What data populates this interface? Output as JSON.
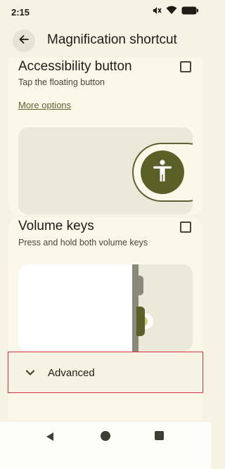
{
  "status_bar": {
    "time": "2:15",
    "icons": [
      "mute-icon",
      "wifi-icon",
      "battery-icon"
    ]
  },
  "app_bar": {
    "title": "Magnification shortcut",
    "back_icon": "arrow-back-icon"
  },
  "options": [
    {
      "title": "Accessibility button",
      "description": "Tap the floating button",
      "link": "More options",
      "checked": false,
      "preview_icon": "accessibility-person-icon"
    },
    {
      "title": "Volume keys",
      "description": "Press and hold both volume keys",
      "checked": false
    }
  ],
  "advanced": {
    "label": "Advanced",
    "icon": "chevron-down-icon"
  },
  "nav_bar": {
    "icons": [
      "nav-back-icon",
      "nav-home-icon",
      "nav-recents-icon"
    ]
  },
  "colors": {
    "background": "#f6f3e4",
    "card": "#fbf8ea",
    "accent": "#5a6128",
    "highlight_border": "#d9343b"
  }
}
